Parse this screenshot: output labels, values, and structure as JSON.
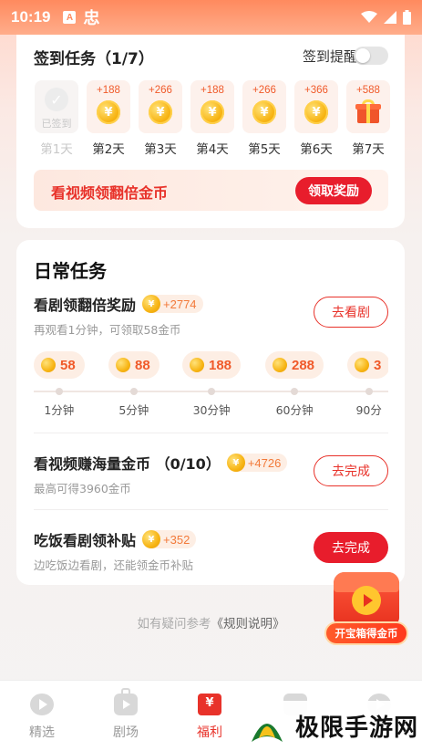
{
  "status_bar": {
    "time": "10:19",
    "app_icon_letter": "A",
    "app_glyph": "忠"
  },
  "checkin": {
    "title": "签到任务（1/7）",
    "remind_label": "签到提醒",
    "remind_enabled": false,
    "days": [
      {
        "reward": "",
        "status": "已签到",
        "label": "第1天",
        "done": true
      },
      {
        "reward": "+188",
        "label": "第2天",
        "done": false
      },
      {
        "reward": "+266",
        "label": "第3天",
        "done": false
      },
      {
        "reward": "+188",
        "label": "第4天",
        "done": false
      },
      {
        "reward": "+266",
        "label": "第5天",
        "done": false
      },
      {
        "reward": "+366",
        "label": "第6天",
        "done": false
      },
      {
        "reward": "+588",
        "label": "第7天",
        "done": false,
        "gift": true
      }
    ],
    "banner_text": "看视频领翻倍金币",
    "banner_button": "领取奖励"
  },
  "daily": {
    "title": "日常任务",
    "tasks": [
      {
        "title": "看剧领翻倍奖励",
        "bonus": "+2774",
        "subtitle": "再观看1分钟，可领取58金币",
        "button": "去看剧"
      },
      {
        "title": "看视频赚海量金币 （0/10）",
        "bonus": "+4726",
        "subtitle": "最高可得3960金币",
        "button": "去完成"
      },
      {
        "title": "吃饭看剧领补贴",
        "bonus": "+352",
        "subtitle": "边吃饭边看剧，还能领金币补贴",
        "button": "去完成"
      }
    ],
    "milestones": [
      {
        "value": "58",
        "label": "1分钟"
      },
      {
        "value": "88",
        "label": "5分钟"
      },
      {
        "value": "188",
        "label": "30分钟"
      },
      {
        "value": "288",
        "label": "60分钟"
      },
      {
        "value": "3",
        "label": "90分"
      }
    ]
  },
  "rules": {
    "prefix": "如有疑问参考",
    "link": "《规则说明》"
  },
  "treasure": {
    "label": "开宝箱得金币"
  },
  "nav": [
    {
      "label": "精选",
      "icon": "play-circle-icon",
      "active": false
    },
    {
      "label": "剧场",
      "icon": "tv-icon",
      "active": false
    },
    {
      "label": "福利",
      "icon": "welfare-icon",
      "active": true
    }
  ],
  "watermark": {
    "text": "极限手游网"
  },
  "colors": {
    "accent": "#e81d2c",
    "coin": "#f7b413",
    "reward_text": "#f05a2a"
  }
}
